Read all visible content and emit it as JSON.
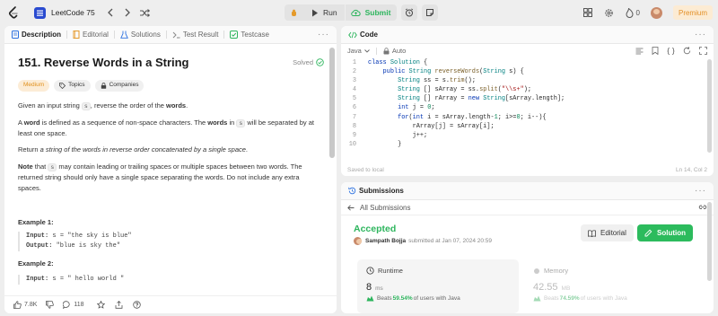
{
  "topbar": {
    "title": "LeetCode 75",
    "run": "Run",
    "submit": "Submit",
    "streak": "0",
    "premium": "Premium"
  },
  "problem": {
    "tabs": [
      "Description",
      "Editorial",
      "Solutions",
      "Test Result",
      "Testcase"
    ],
    "title": "151. Reverse Words in a String",
    "solved": "Solved",
    "tags": [
      "Medium",
      "Topics",
      "Companies"
    ],
    "intro_a": "Given an input string ",
    "intro_code": "s",
    "intro_b": ", reverse the order of the ",
    "intro_bold": "words",
    "intro_c": ".",
    "word_a": "A ",
    "word_bold1": "word",
    "word_b": " is defined as a sequence of non-space characters. The ",
    "word_bold2": "words",
    "word_c": " in ",
    "word_code": "s",
    "word_d": " will be separated by at least one space.",
    "return_a": "Return ",
    "return_italic": "a string of the words in reverse order concatenated by a single space",
    "return_b": ".",
    "note_bold": "Note",
    "note_a": " that ",
    "note_code": "s",
    "note_b": " may contain leading or trailing spaces or multiple spaces between two words. The returned string should only have a single space separating the words. Do not include any extra spaces.",
    "ex1_title": "Example 1:",
    "ex1_input_label": "Input:",
    "ex1_input": " s = \"the sky is blue\"",
    "ex1_output_label": "Output:",
    "ex1_output": " \"blue is sky the\"",
    "ex2_title": "Example 2:",
    "ex2_input_label": "Input:",
    "ex2_input": " s = \"  hello world  \""
  },
  "footer": {
    "likes": "7.8K",
    "comments": "118"
  },
  "code_panel": {
    "title": "Code",
    "language": "Java",
    "mode": "Auto",
    "saved": "Saved to local",
    "position": "Ln 14, Col 2",
    "line_numbers": [
      "1",
      "2",
      "3",
      "4",
      "5",
      "6",
      "7",
      "8",
      "9",
      "10"
    ]
  },
  "submissions": {
    "title": "Submissions",
    "back": "All Submissions",
    "status": "Accepted",
    "user": "Sampath Bojja",
    "submitted_at": "submitted at Jan 07, 2024 20:59",
    "editorial": "Editorial",
    "solution": "Solution",
    "runtime_label": "Runtime",
    "runtime_value": "8",
    "runtime_unit": "ms",
    "runtime_beats_a": "Beats ",
    "runtime_beats_pct": "59.54%",
    "runtime_beats_b": " of users with Java",
    "memory_label": "Memory",
    "memory_value": "42.55",
    "memory_unit": "MB",
    "memory_beats_a": "Beats ",
    "memory_beats_pct": "74.59%",
    "memory_beats_b": " of users with Java"
  }
}
